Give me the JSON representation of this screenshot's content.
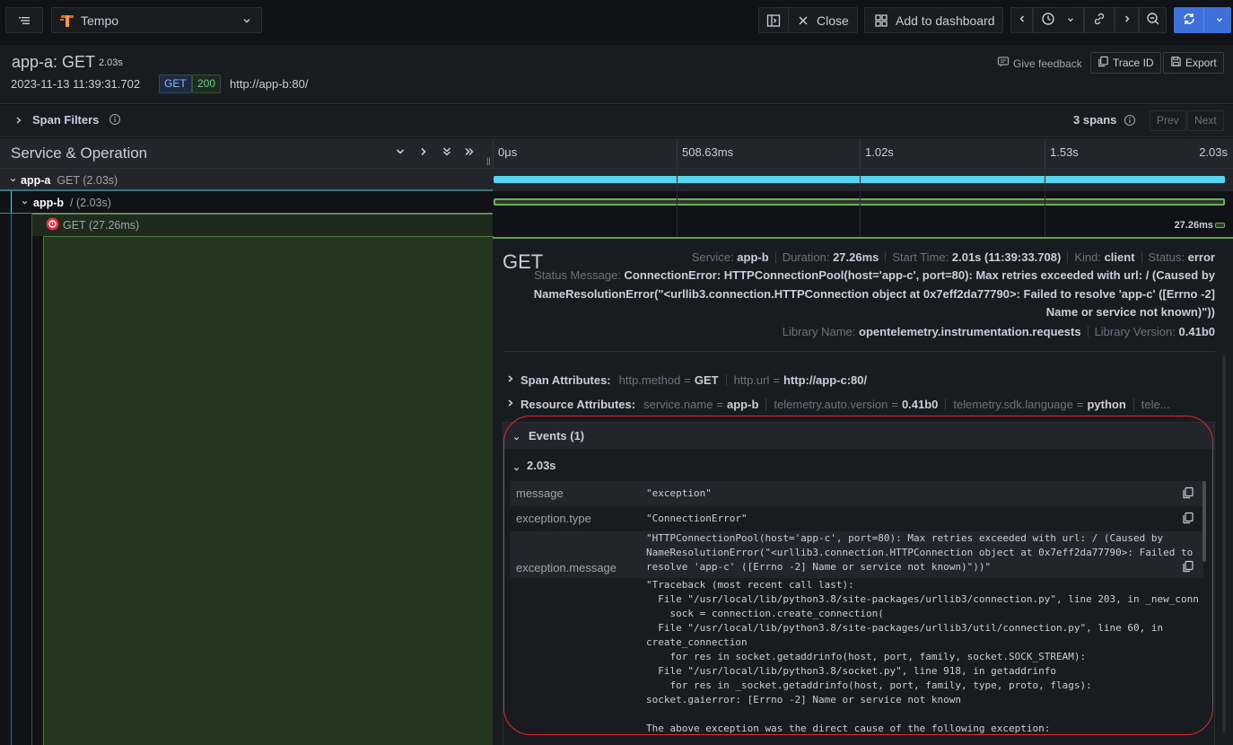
{
  "toolbar": {
    "datasource": "Tempo",
    "close_label": "Close",
    "add_dashboard_label": "Add to dashboard"
  },
  "trace": {
    "title": "app-a: GET",
    "duration": "2.03s",
    "start_time": "2023-11-13 11:39:31.702",
    "method_tag": "GET",
    "status_tag": "200",
    "url": "http://app-b:80/",
    "feedback_label": "Give feedback",
    "trace_id_label": "Trace ID",
    "export_label": "Export"
  },
  "filters": {
    "label": "Span Filters",
    "spans_count": "3 spans",
    "prev_label": "Prev",
    "next_label": "Next"
  },
  "timeline": {
    "column_title": "Service & Operation",
    "ticks": [
      "0μs",
      "508.63ms",
      "1.02s",
      "1.53s",
      "2.03s"
    ]
  },
  "spans": [
    {
      "service": "app-a",
      "operation": "GET (2.03s)",
      "color": "#56d6ee",
      "start_fraction": 0.0,
      "duration_fraction": 1.0
    },
    {
      "service": "app-b",
      "operation": "/ (2.03s)",
      "color": "#6cae5a",
      "start_fraction": 0.0,
      "duration_fraction": 1.0
    },
    {
      "service": "",
      "operation": "GET (27.26ms)",
      "color": "#6cae5a",
      "start_fraction": 0.9866,
      "duration_fraction": 0.0134,
      "bar_label": "27.26ms"
    }
  ],
  "detail": {
    "operation": "GET",
    "service_label": "Service:",
    "service": "app-b",
    "duration_label": "Duration:",
    "duration": "27.26ms",
    "start_label": "Start Time:",
    "start": "2.01s (11:39:33.708)",
    "kind_label": "Kind:",
    "kind": "client",
    "status_label": "Status:",
    "status": "error",
    "status_message_label": "Status Message:",
    "status_message": "ConnectionError: HTTPConnectionPool(host='app-c', port=80): Max retries exceeded with url: / (Caused by NameResolutionError(\"<urllib3.connection.HTTPConnection object at 0x7eff2da77790>: Failed to resolve 'app-c' ([Errno -2] Name or service not known)\"))",
    "library_name_label": "Library Name:",
    "library_name": "opentelemetry.instrumentation.requests",
    "library_version_label": "Library Version:",
    "library_version": "0.41b0",
    "span_attributes_label": "Span Attributes:",
    "span_attributes": [
      {
        "key": "http.method",
        "value": "GET"
      },
      {
        "key": "http.url",
        "value": "http://app-c:80/"
      }
    ],
    "resource_attributes_label": "Resource Attributes:",
    "resource_attributes": [
      {
        "key": "service.name",
        "value": "app-b"
      },
      {
        "key": "telemetry.auto.version",
        "value": "0.41b0"
      },
      {
        "key": "telemetry.sdk.language",
        "value": "python"
      }
    ],
    "resource_more": "tele...",
    "events_label": "Events (1)",
    "event_time": "2.03s",
    "event": {
      "message_key": "message",
      "message": "\"exception\"",
      "type_key": "exception.type",
      "type": "\"ConnectionError\"",
      "msg_key": "exception.message",
      "msg": "\"HTTPConnectionPool(host='app-c', port=80): Max retries exceeded with url: / (Caused by\nNameResolutionError(\"<urllib3.connection.HTTPConnection object at 0x7eff2da77790>: Failed to\nresolve 'app-c' ([Errno -2] Name or service not known)\"))\"",
      "stacktrace": "\"Traceback (most recent call last):\n  File \"/usr/local/lib/python3.8/site-packages/urllib3/connection.py\", line 203, in _new_conn\n    sock = connection.create_connection(\n  File \"/usr/local/lib/python3.8/site-packages/urllib3/util/connection.py\", line 60, in\ncreate_connection\n    for res in socket.getaddrinfo(host, port, family, socket.SOCK_STREAM):\n  File \"/usr/local/lib/python3.8/socket.py\", line 918, in getaddrinfo\n    for res in _socket.getaddrinfo(host, port, family, type, proto, flags):\nsocket.gaierror: [Errno -2] Name or service not known\n\nThe above exception was the direct cause of the following exception:"
    }
  },
  "colors": {
    "accent": "#3d71d9",
    "annotation": "#e02d2d",
    "error": "#e02f44"
  }
}
